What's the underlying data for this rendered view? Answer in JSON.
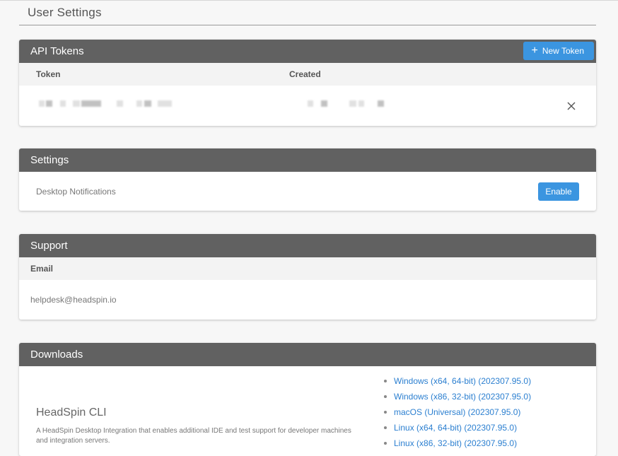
{
  "page": {
    "title": "User Settings"
  },
  "api_tokens": {
    "header": "API Tokens",
    "new_token_label": "New Token",
    "columns": {
      "token": "Token",
      "created": "Created"
    }
  },
  "settings": {
    "header": "Settings",
    "desktop_notifications_label": "Desktop Notifications",
    "enable_label": "Enable"
  },
  "support": {
    "header": "Support",
    "email_header": "Email",
    "email_value": "helpdesk@headspin.io"
  },
  "downloads": {
    "header": "Downloads",
    "cli_title": "HeadSpin CLI",
    "cli_description": "A HeadSpin Desktop Integration that enables additional IDE and test support for developer machines and integration servers.",
    "links": [
      "Windows (x64, 64-bit) (202307.95.0)",
      "Windows (x86, 32-bit) (202307.95.0)",
      "macOS (Universal) (202307.95.0)",
      "Linux (x64, 64-bit) (202307.95.0)",
      "Linux (x86, 32-bit) (202307.95.0)"
    ]
  },
  "colors": {
    "panel_header": "#616161",
    "accent_button": "#3b95e0",
    "link": "#2b7fd0"
  }
}
